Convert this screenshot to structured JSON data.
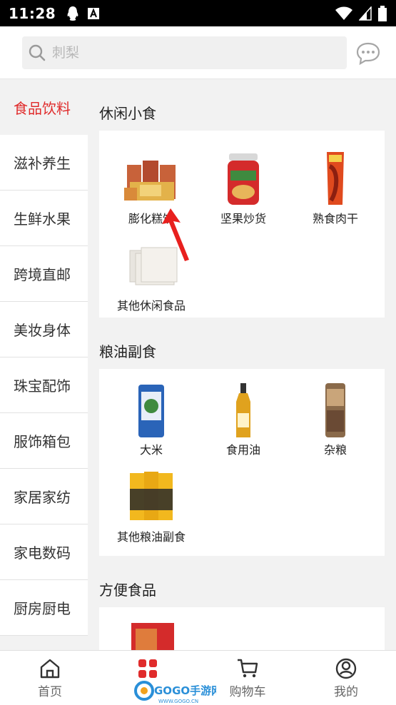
{
  "status_bar": {
    "time": "11:28"
  },
  "search": {
    "placeholder": "刺梨"
  },
  "sidebar": {
    "items": [
      {
        "label": "食品饮料",
        "active": true
      },
      {
        "label": "滋补养生"
      },
      {
        "label": "生鲜水果"
      },
      {
        "label": "跨境直邮"
      },
      {
        "label": "美妆身体"
      },
      {
        "label": "珠宝配饰"
      },
      {
        "label": "服饰箱包"
      },
      {
        "label": "家居家纺"
      },
      {
        "label": "家电数码"
      },
      {
        "label": "厨房厨电"
      }
    ]
  },
  "sections": [
    {
      "title": "休闲小食",
      "items": [
        {
          "label": "膨化糕饼",
          "icon": "snack-box-image"
        },
        {
          "label": "坚果炒货",
          "icon": "nut-jar-image"
        },
        {
          "label": "熟食肉干",
          "icon": "jerky-pack-image"
        },
        {
          "label": "其他休闲食品",
          "icon": "gift-box-image"
        }
      ]
    },
    {
      "title": "粮油副食",
      "items": [
        {
          "label": "大米",
          "icon": "rice-bag-image"
        },
        {
          "label": "食用油",
          "icon": "oil-bottle-image"
        },
        {
          "label": "杂粮",
          "icon": "grain-bag-image"
        },
        {
          "label": "其他粮油副食",
          "icon": "noodle-pack-image"
        }
      ]
    },
    {
      "title": "方便食品",
      "items": [
        {
          "label": "",
          "icon": "red-gift-box-image"
        }
      ]
    }
  ],
  "bottom_nav": {
    "items": [
      {
        "label": "首页",
        "icon": "home-icon"
      },
      {
        "label": "分类",
        "icon": "category-icon",
        "active": true
      },
      {
        "label": "购物车",
        "icon": "cart-icon"
      },
      {
        "label": "我的",
        "icon": "profile-icon"
      }
    ]
  },
  "watermark": {
    "text": "GOGO手游网",
    "sub": "WWW.GOGO.CN"
  },
  "colors": {
    "accent": "#e02b2b",
    "background": "#f2f2f2",
    "status_bar": "#000000"
  }
}
